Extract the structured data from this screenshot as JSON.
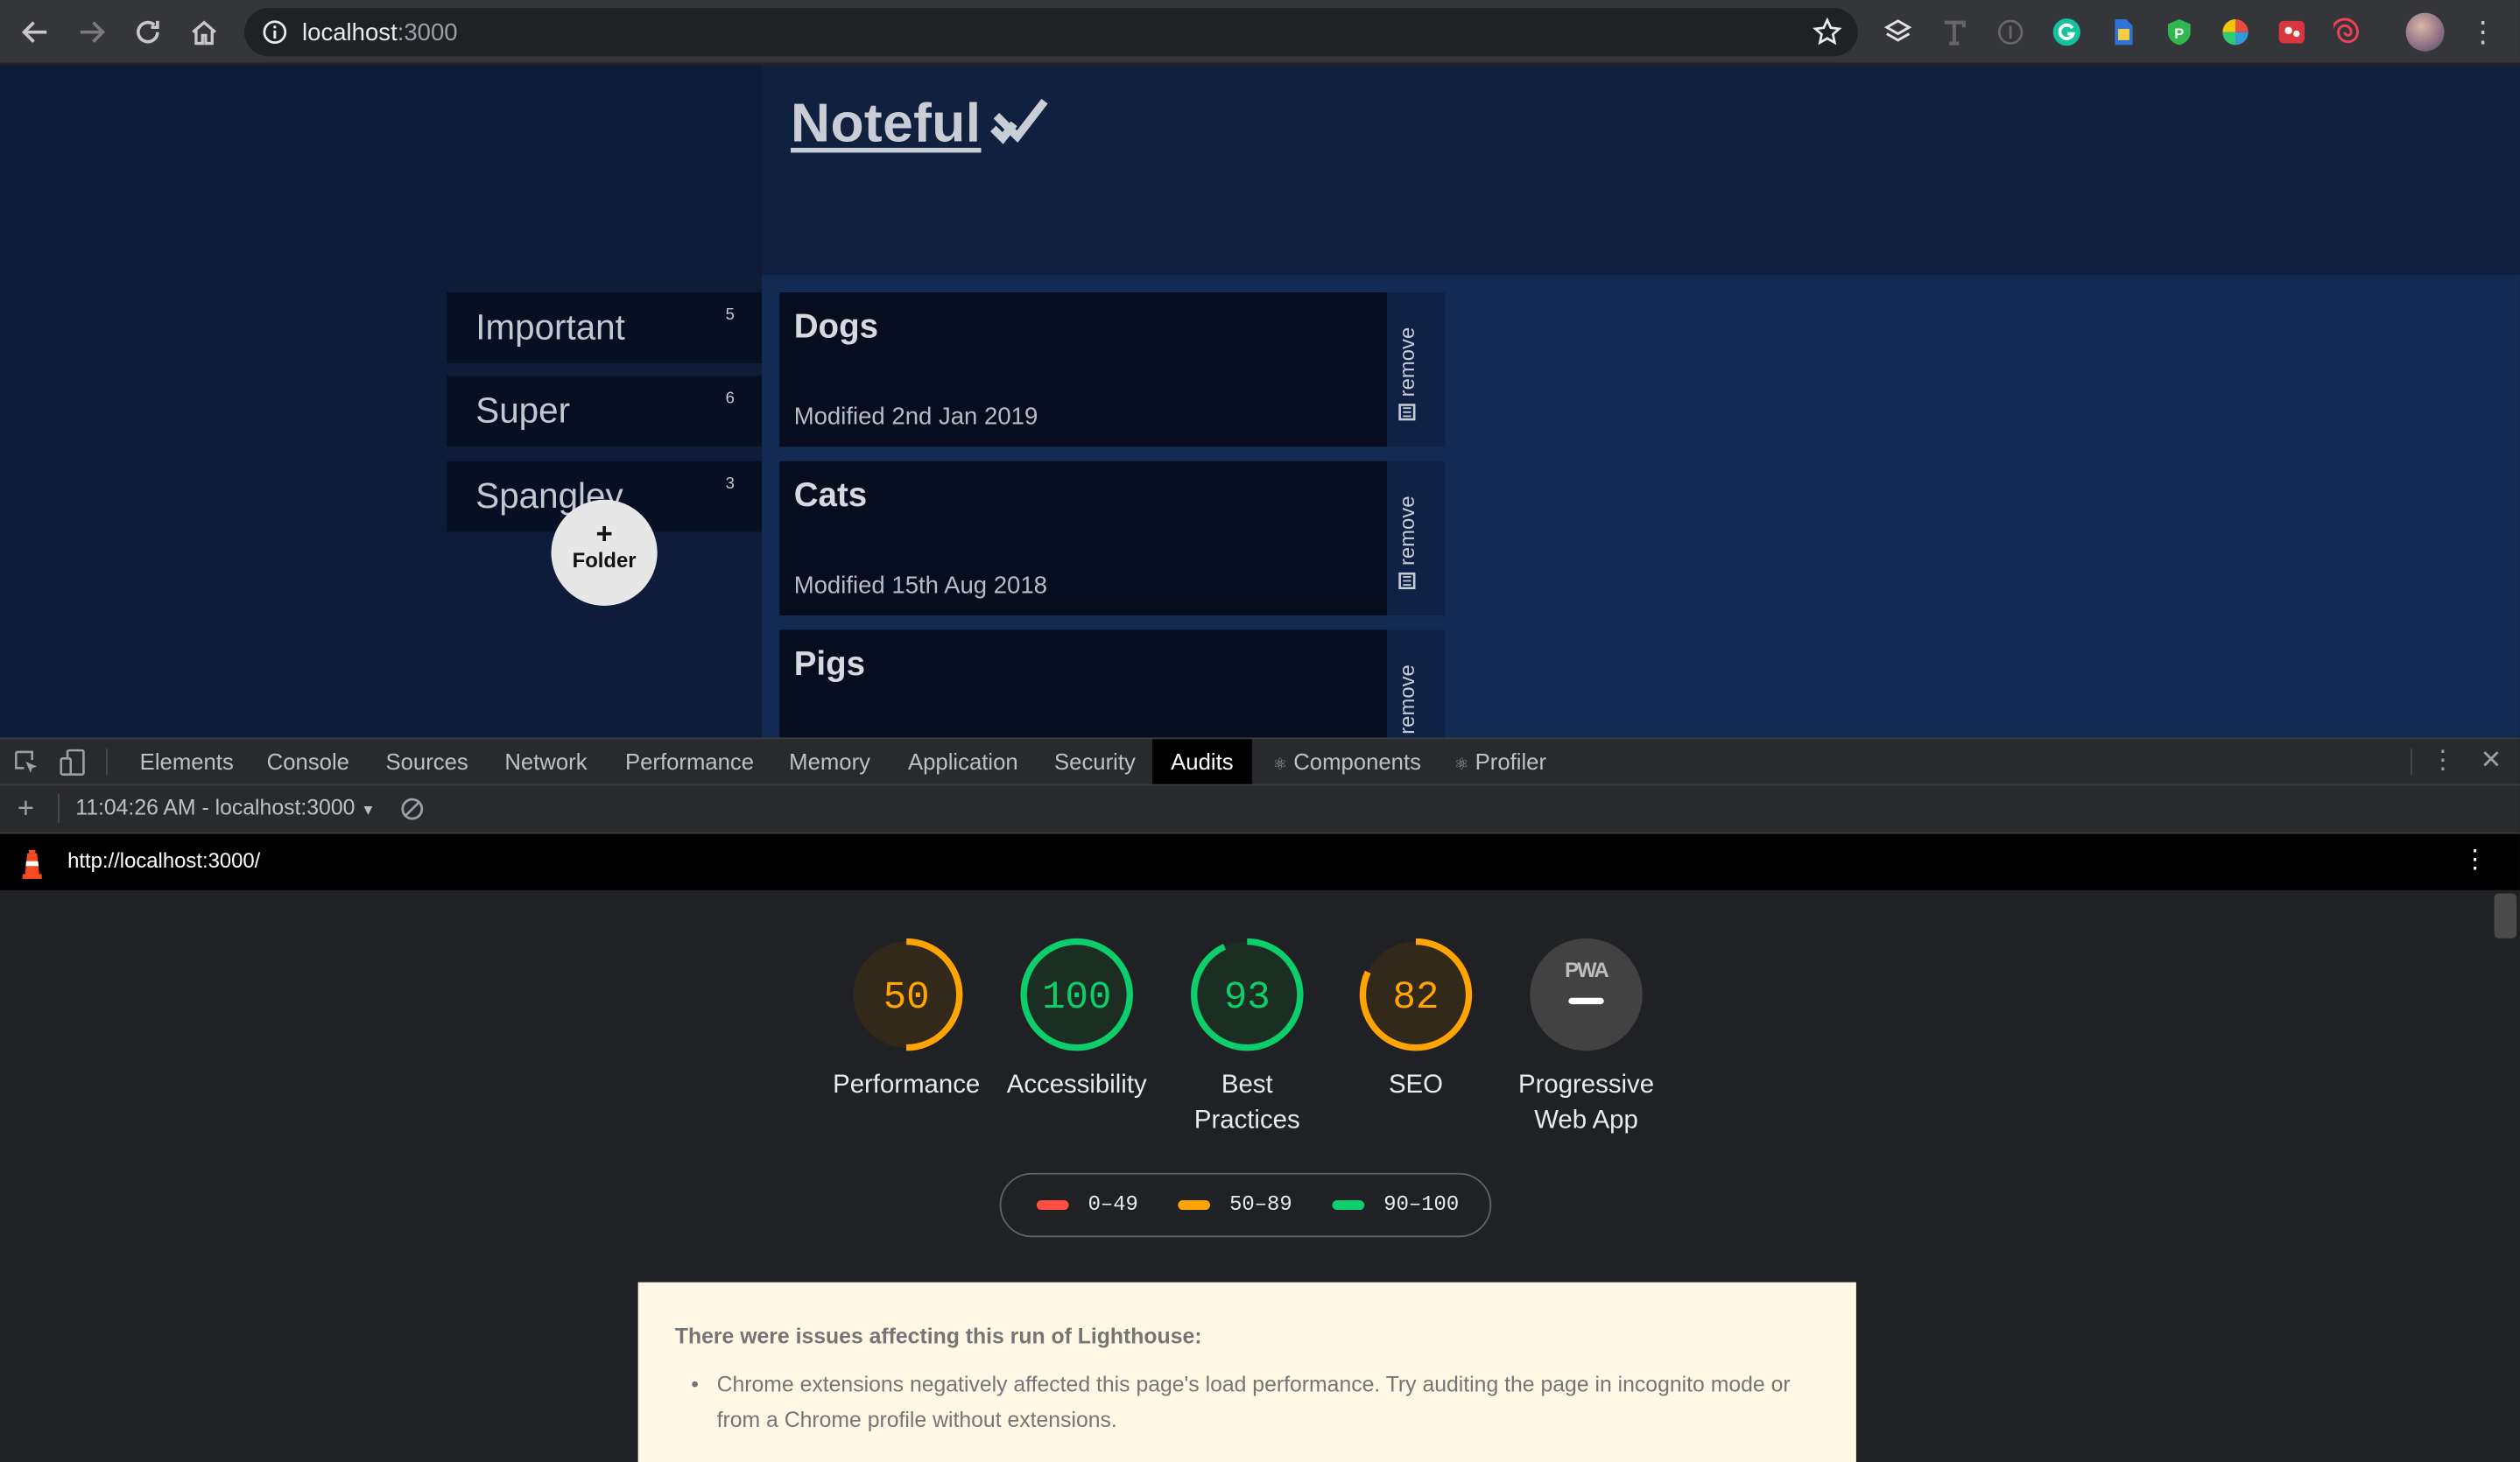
{
  "browser": {
    "url_host": "localhost",
    "url_port": ":3000"
  },
  "app": {
    "title": "Noteful",
    "folders": [
      {
        "name": "Important",
        "count": "5"
      },
      {
        "name": "Super",
        "count": "6"
      },
      {
        "name": "Spangley",
        "count": "3"
      }
    ],
    "add_folder_plus": "+",
    "add_folder_label": "Folder",
    "notes": [
      {
        "title": "Dogs",
        "modified": "Modified 2nd Jan 2019",
        "remove_label": "remove"
      },
      {
        "title": "Cats",
        "modified": "Modified 15th Aug 2018",
        "remove_label": "remove"
      },
      {
        "title": "Pigs",
        "modified": "",
        "remove_label": "remove"
      }
    ]
  },
  "devtools": {
    "tabs": [
      "Elements",
      "Console",
      "Sources",
      "Network",
      "Performance",
      "Memory",
      "Application",
      "Security",
      "Audits",
      "Components",
      "Profiler"
    ],
    "active_tab": "Audits",
    "report_select": "11:04:26 AM - localhost:3000",
    "report_url": "http://localhost:3000/"
  },
  "lighthouse": {
    "categories": [
      {
        "name": "Performance",
        "score": "50",
        "status": "average"
      },
      {
        "name": "Accessibility",
        "score": "100",
        "status": "pass"
      },
      {
        "name": "Best Practices",
        "score": "93",
        "status": "pass"
      },
      {
        "name": "SEO",
        "score": "82",
        "status": "average"
      },
      {
        "name": "Progressive Web App",
        "score": "PWA",
        "status": "na"
      }
    ],
    "legend": [
      {
        "label": "0–49",
        "color": "#ff4e42"
      },
      {
        "label": "50–89",
        "color": "#ffa400"
      },
      {
        "label": "90–100",
        "color": "#0cce6b"
      }
    ],
    "colors": {
      "fail": "#ff4e42",
      "average": "#ffa400",
      "pass": "#0cce6b"
    },
    "warning_title": "There were issues affecting this run of Lighthouse:",
    "warning_items": [
      "Chrome extensions negatively affected this page's load performance. Try auditing the page in incognito mode or from a Chrome profile without extensions."
    ]
  }
}
